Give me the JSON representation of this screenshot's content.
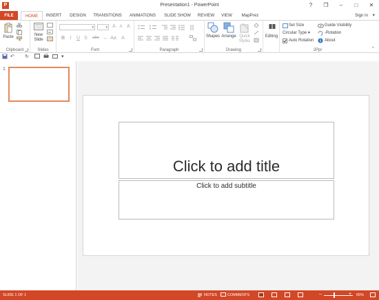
{
  "window": {
    "title": "Presentation1 - PowerPoint",
    "app_logo": "P",
    "controls": [
      "?",
      "❐",
      "–",
      "□",
      "✕"
    ]
  },
  "tabs": [
    {
      "label": "FILE"
    },
    {
      "label": "HOME"
    },
    {
      "label": "INSERT"
    },
    {
      "label": "DESIGN"
    },
    {
      "label": "TRANSITIONS"
    },
    {
      "label": "ANIMATIONS"
    },
    {
      "label": "SLIDE SHOW"
    },
    {
      "label": "REVIEW"
    },
    {
      "label": "VIEW"
    },
    {
      "label": "MapPrez"
    }
  ],
  "signin": "Sign in",
  "ribbon": {
    "clipboard": {
      "label": "Clipboard",
      "paste": "Paste"
    },
    "slides": {
      "label": "Slides",
      "new_slide_1": "New",
      "new_slide_2": "Slide"
    },
    "font": {
      "label": "Font",
      "bold": "B",
      "italic": "I",
      "underline": "U",
      "strike": "S",
      "shadow": "abc"
    },
    "paragraph": {
      "label": "Paragraph"
    },
    "drawing": {
      "label": "Drawing",
      "shapes": "Shapes",
      "arrange": "Arrange",
      "quick_styles_1": "Quick",
      "quick_styles_2": "Styles"
    },
    "editing": {
      "label": "Editing"
    },
    "ppr": {
      "label": "2Ppr",
      "set_size": "Set Size",
      "circular_type": "Circular Type",
      "auto_rotation": "Auto Rotation",
      "guide_visibility": "Guide Visibility",
      "rotation": "-Rotation",
      "about": "About"
    }
  },
  "slides_panel": {
    "number": "1"
  },
  "slide": {
    "title_placeholder": "Click to add title",
    "subtitle_placeholder": "Click to add subtitle"
  },
  "status": {
    "slide_info": "SLIDE 1 OF 1",
    "notes": "NOTES",
    "comments": "COMMENTS",
    "zoom": "65%",
    "zoom_minus": "–",
    "zoom_plus": "+"
  },
  "colors": {
    "accent": "#d24726",
    "thumb_border": "#e5875b"
  }
}
